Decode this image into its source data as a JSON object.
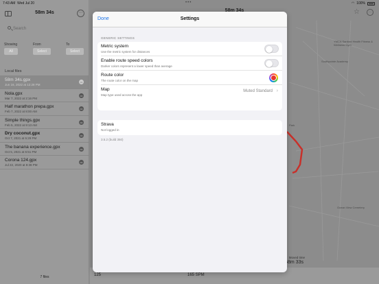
{
  "status_bar": {
    "time": "7:43 AM",
    "date": "Wed Jul 20",
    "battery": "100%"
  },
  "sidebar": {
    "title": "58m 34s",
    "search_placeholder": "Search",
    "filters": {
      "showing_label": "Showing",
      "showing_value": "All",
      "from_label": "From",
      "from_value": "Select",
      "to_label": "To",
      "to_value": "Select"
    },
    "section_label": "Local files",
    "files": [
      {
        "name": "58m 34s.gpx",
        "date": "Jun 16, 2022 at 12:28 PM",
        "selected": true,
        "bold": false
      },
      {
        "name": "Nola.gpx",
        "date": "Mar 7, 2022 at 2:16 PM",
        "selected": false,
        "bold": false
      },
      {
        "name": "Half marathon prepa.gpx",
        "date": "Feb 7, 2022 at 8:00 AM",
        "selected": false,
        "bold": false
      },
      {
        "name": "Simple things.gpx",
        "date": "Feb 5, 2022 at 9:13 AM",
        "selected": false,
        "bold": false
      },
      {
        "name": "Dry coconut.gpx",
        "date": "Oct 7, 2021 at 5:29 PM",
        "selected": false,
        "bold": true
      },
      {
        "name": "The banana experience.gpx",
        "date": "Oct 5, 2021 at 6:51 PM",
        "selected": false,
        "bold": false
      },
      {
        "name": "Corona 124.gpx",
        "date": "Jul 22, 2020 at 8:38 PM",
        "selected": false,
        "bold": false
      }
    ],
    "file_count": "7 files"
  },
  "map": {
    "title": "58m 34s",
    "labels": {
      "gym": "YMCA Sanford Health Fitness & Wellness Gym",
      "southpointe": "Southpointe Academy",
      "park": "Park",
      "cemetery": "Ocean View Cemetery"
    },
    "time_label": "Moved time",
    "time_value": "58m 33s",
    "bottom_left": "125",
    "bottom_mid": "165 SPM"
  },
  "settings": {
    "done_label": "Done",
    "title": "Settings",
    "group_label": "GENERIC SETTINGS",
    "rows": {
      "metric": {
        "title": "Metric system",
        "subtitle": "Use the metric system for distances",
        "on": false
      },
      "speed_colors": {
        "title": "Enable route speed colors",
        "subtitle": "Darker colors represent a lower speed than average",
        "on": false
      },
      "route_color": {
        "title": "Route color",
        "subtitle": "The route color on the map",
        "color": "#e8372c"
      },
      "map_type": {
        "title": "Map",
        "subtitle": "Map type used across the app",
        "value": "Muted Standard"
      }
    },
    "strava": {
      "title": "Strava",
      "subtitle": "Not logged in"
    },
    "version": "3.5.2 (build 350)"
  },
  "colors": {
    "accent": "#1a73e8",
    "route": "#c8302a"
  }
}
